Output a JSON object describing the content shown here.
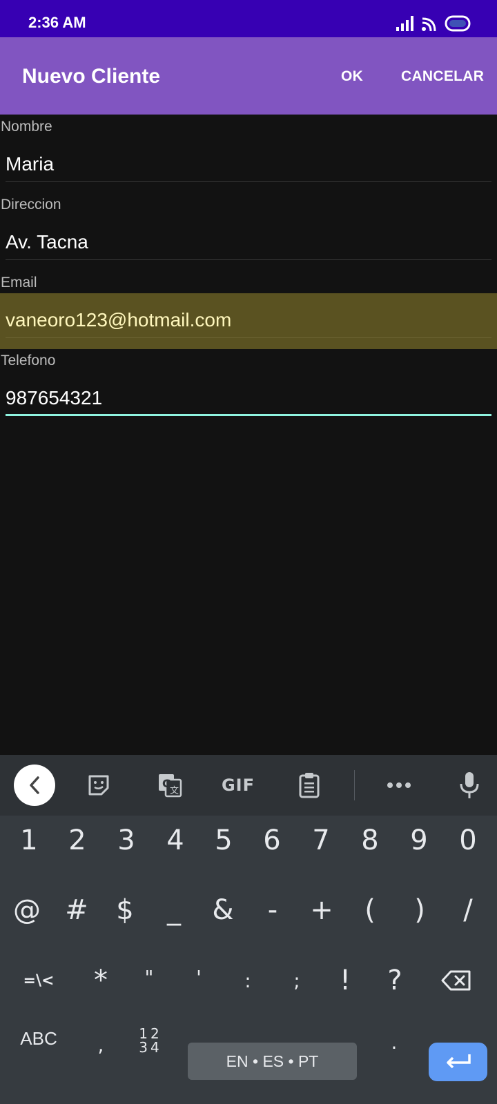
{
  "status_bar": {
    "time": "2:36 AM"
  },
  "app_bar": {
    "title": "Nuevo Cliente",
    "ok_label": "OK",
    "cancel_label": "CANCELAR"
  },
  "form": {
    "nombre": {
      "label": "Nombre",
      "value": "Maria"
    },
    "direccion": {
      "label": "Direccion",
      "value": "Av. Tacna"
    },
    "email": {
      "label": "Email",
      "value": "vaneoro123@hotmail.com"
    },
    "telefono": {
      "label": "Telefono",
      "value": "987654321"
    }
  },
  "keyboard": {
    "toolbar": {
      "gif_label": "GIF"
    },
    "row1": [
      "1",
      "2",
      "3",
      "4",
      "5",
      "6",
      "7",
      "8",
      "9",
      "0"
    ],
    "row2": [
      "@",
      "#",
      "$",
      "_",
      "&",
      "-",
      "+",
      "(",
      ")",
      "/"
    ],
    "row3": [
      "=\\<",
      "*",
      "\"",
      "'",
      ":",
      ";",
      "!",
      "?"
    ],
    "row4": {
      "abc": "ABC",
      "comma": ",",
      "numpad_top": "12",
      "numpad_bottom": "34",
      "space": "EN • ES • PT",
      "period": "."
    }
  },
  "colors": {
    "status_bar": "#3700b3",
    "app_bar": "#8155c1",
    "focus_underline": "#8ff3df",
    "autofill_highlight": "#5a5221",
    "enter_key": "#5f9af4"
  }
}
